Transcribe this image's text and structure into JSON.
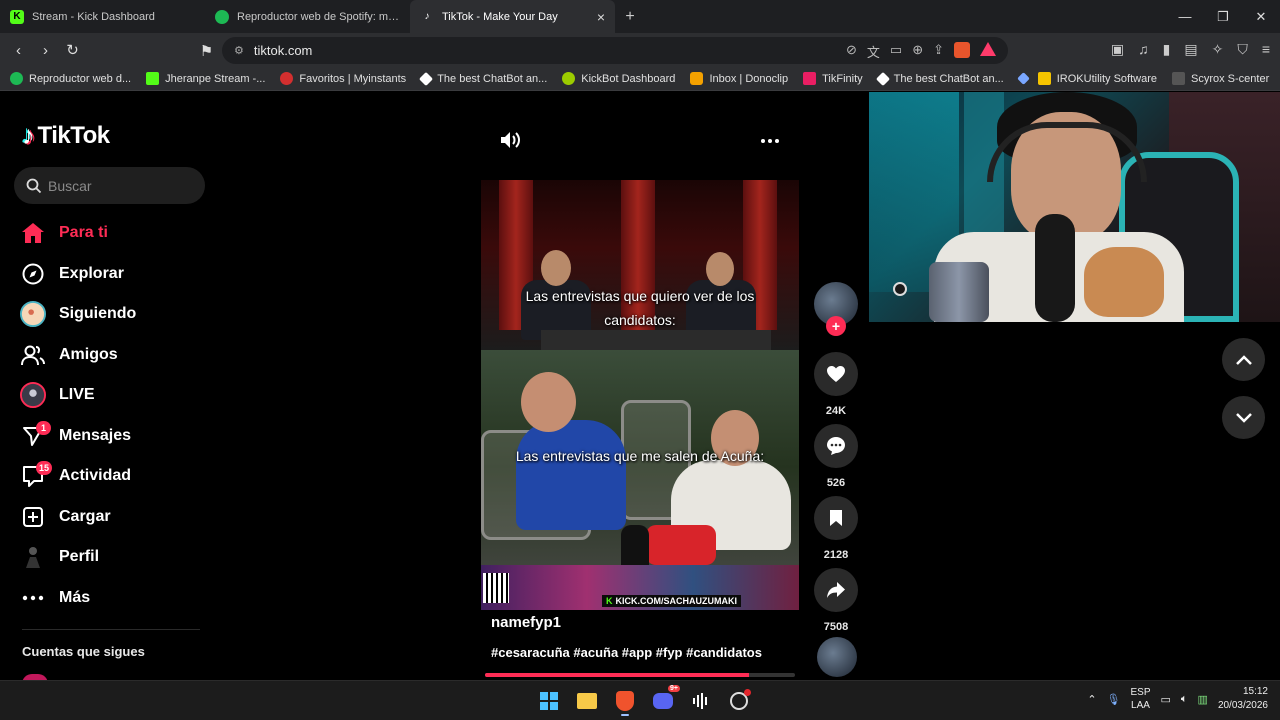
{
  "browser": {
    "tabs": [
      {
        "title": "Stream - Kick Dashboard",
        "favicon_color": "#53fc18",
        "active": false
      },
      {
        "title": "Reproductor web de Spotify: música para todos",
        "favicon_color": "#1db954",
        "active": false
      },
      {
        "title": "TikTok - Make Your Day",
        "favicon_color": "#000000",
        "active": true
      }
    ],
    "new_tab_label": "+",
    "url": "tiktok.com",
    "bookmarks": [
      {
        "label": "Reproductor web d...",
        "color": "#1db954"
      },
      {
        "label": "Jheranpe Stream -...",
        "color": "#53fc18"
      },
      {
        "label": "Favoritos | Myinstants",
        "color": "#d32f2f"
      },
      {
        "label": "The best ChatBot an...",
        "color": "#ffffff"
      },
      {
        "label": "KickBot Dashboard",
        "color": "#9ccc00"
      },
      {
        "label": "Inbox | Donoclip",
        "color": "#f4a100"
      },
      {
        "label": "TikFinity",
        "color": "#e91e63"
      },
      {
        "label": "The best ChatBot an...",
        "color": "#ffffff"
      },
      {
        "label": "IROKUtility Software",
        "color": "#f5c400"
      },
      {
        "label": "Scyrox S-center",
        "color": "#555555"
      }
    ]
  },
  "tiktok": {
    "logo_text": "TikTok",
    "search_placeholder": "Buscar",
    "nav": [
      {
        "label": "Para ti",
        "icon": "home-icon",
        "active": true
      },
      {
        "label": "Explorar",
        "icon": "compass-icon"
      },
      {
        "label": "Siguiendo",
        "icon": "following-avatar-icon"
      },
      {
        "label": "Amigos",
        "icon": "friends-icon"
      },
      {
        "label": "LIVE",
        "icon": "live-avatar-icon"
      },
      {
        "label": "Mensajes",
        "icon": "messages-icon",
        "badge": "1"
      },
      {
        "label": "Actividad",
        "icon": "activity-icon",
        "badge": "15"
      },
      {
        "label": "Cargar",
        "icon": "upload-icon"
      },
      {
        "label": "Perfil",
        "icon": "profile-icon"
      },
      {
        "label": "Más",
        "icon": "more-icon"
      }
    ],
    "following_title": "Cuentas que sigues",
    "video": {
      "caption_top": "Las entrevistas que quiero ver de los candidatos:",
      "caption_bottom": "Las entrevistas que me salen de Acuña:",
      "kick_tag_prefix": "K",
      "kick_tag": "KICK.COM/SACHAUZUMAKI",
      "author": "namefyp1",
      "description": "#cesaracuña #acuña #app #fyp #candidatos",
      "progress": 0.85
    },
    "actions": {
      "likes": "24K",
      "comments": "526",
      "saves": "2128",
      "shares": "7508"
    }
  },
  "taskbar": {
    "lang_line1": "ESP",
    "lang_line2": "LAA",
    "time": "15:12",
    "date": "20/03/2026",
    "discord_badge": "9+"
  },
  "colors": {
    "accent": "#fe2c55",
    "kick_green": "#53fc18"
  }
}
